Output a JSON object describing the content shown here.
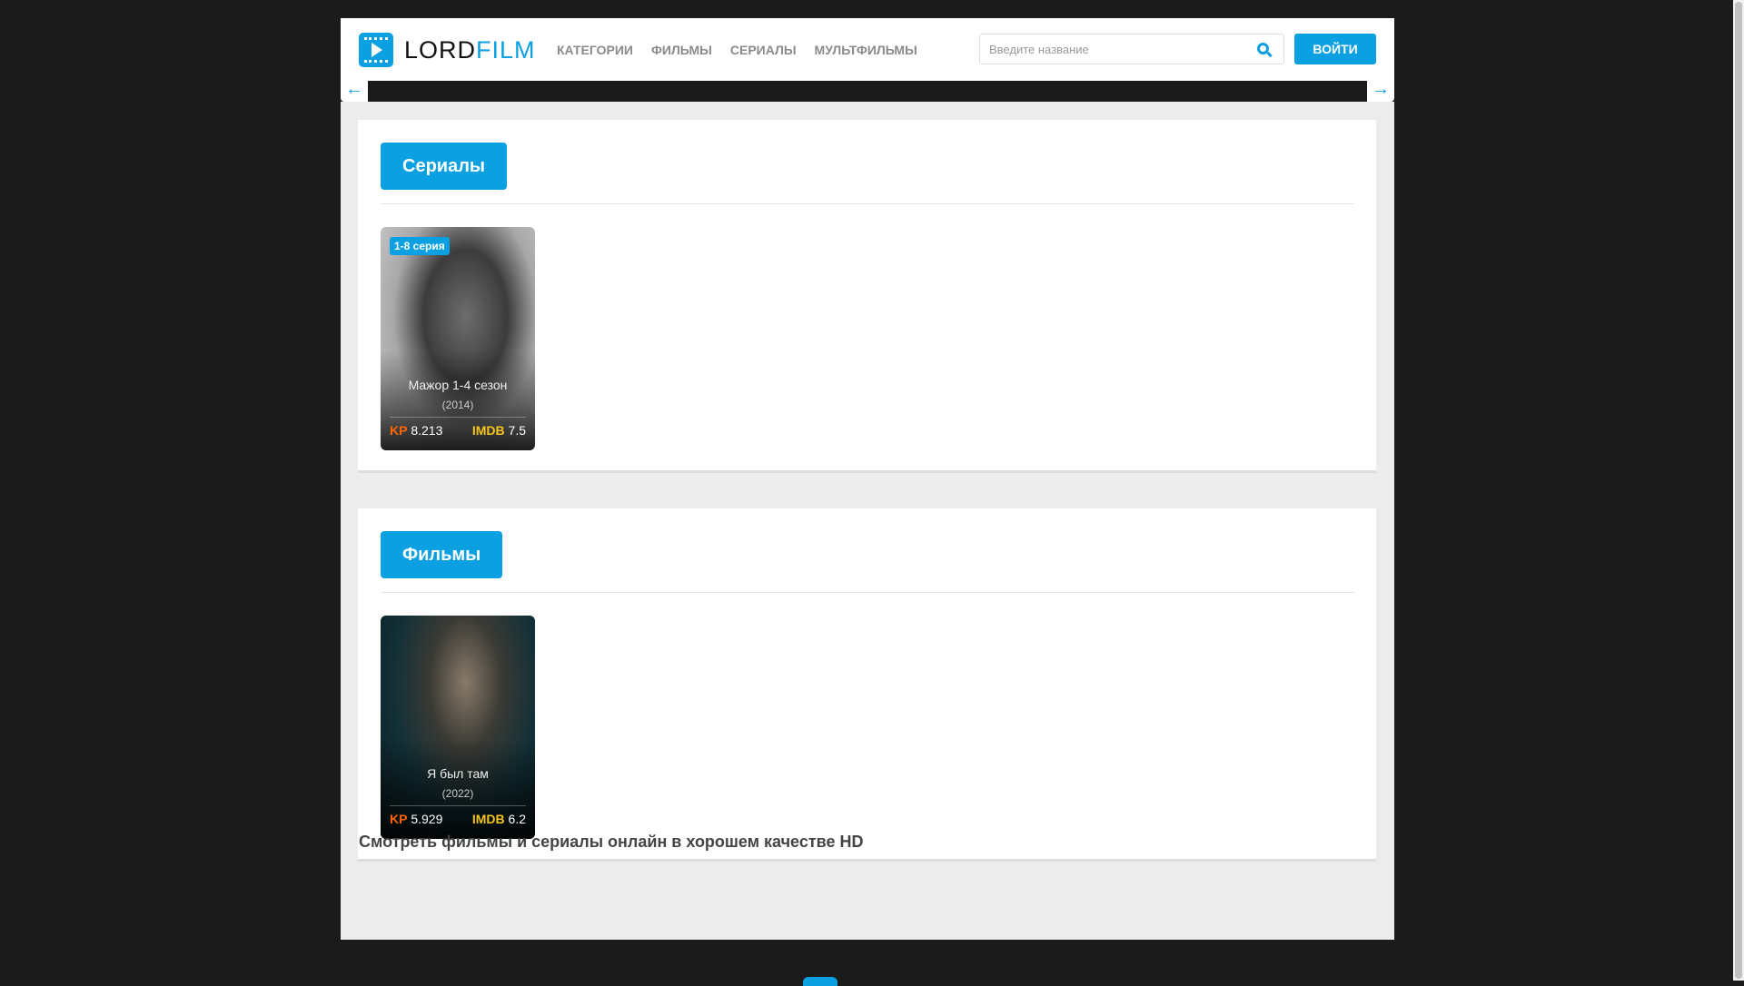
{
  "logo": {
    "part1": "LORD",
    "part2": "FILM"
  },
  "nav": [
    "КАТЕГОРИИ",
    "ФИЛЬМЫ",
    "СЕРИАЛЫ",
    "МУЛЬТФИЛЬМЫ"
  ],
  "search": {
    "placeholder": "Введите название"
  },
  "login": "ВОЙТИ",
  "sections": [
    {
      "title": "Сериалы",
      "items": [
        {
          "badge": "1-8 серия",
          "title": "Мажор 1-4 сезон",
          "year": "(2014)",
          "kp_label": "KP",
          "kp": "8.213",
          "imdb_label": "IMDB",
          "imdb": "7.5"
        }
      ]
    },
    {
      "title": "Фильмы",
      "items": [
        {
          "title": "Я был там",
          "year": "(2022)",
          "kp_label": "KP",
          "kp": "5.929",
          "imdb_label": "IMDB",
          "imdb": "6.2"
        }
      ]
    }
  ],
  "seo_title": "Смотреть фильмы и сериалы онлайн в хорошем качестве HD"
}
